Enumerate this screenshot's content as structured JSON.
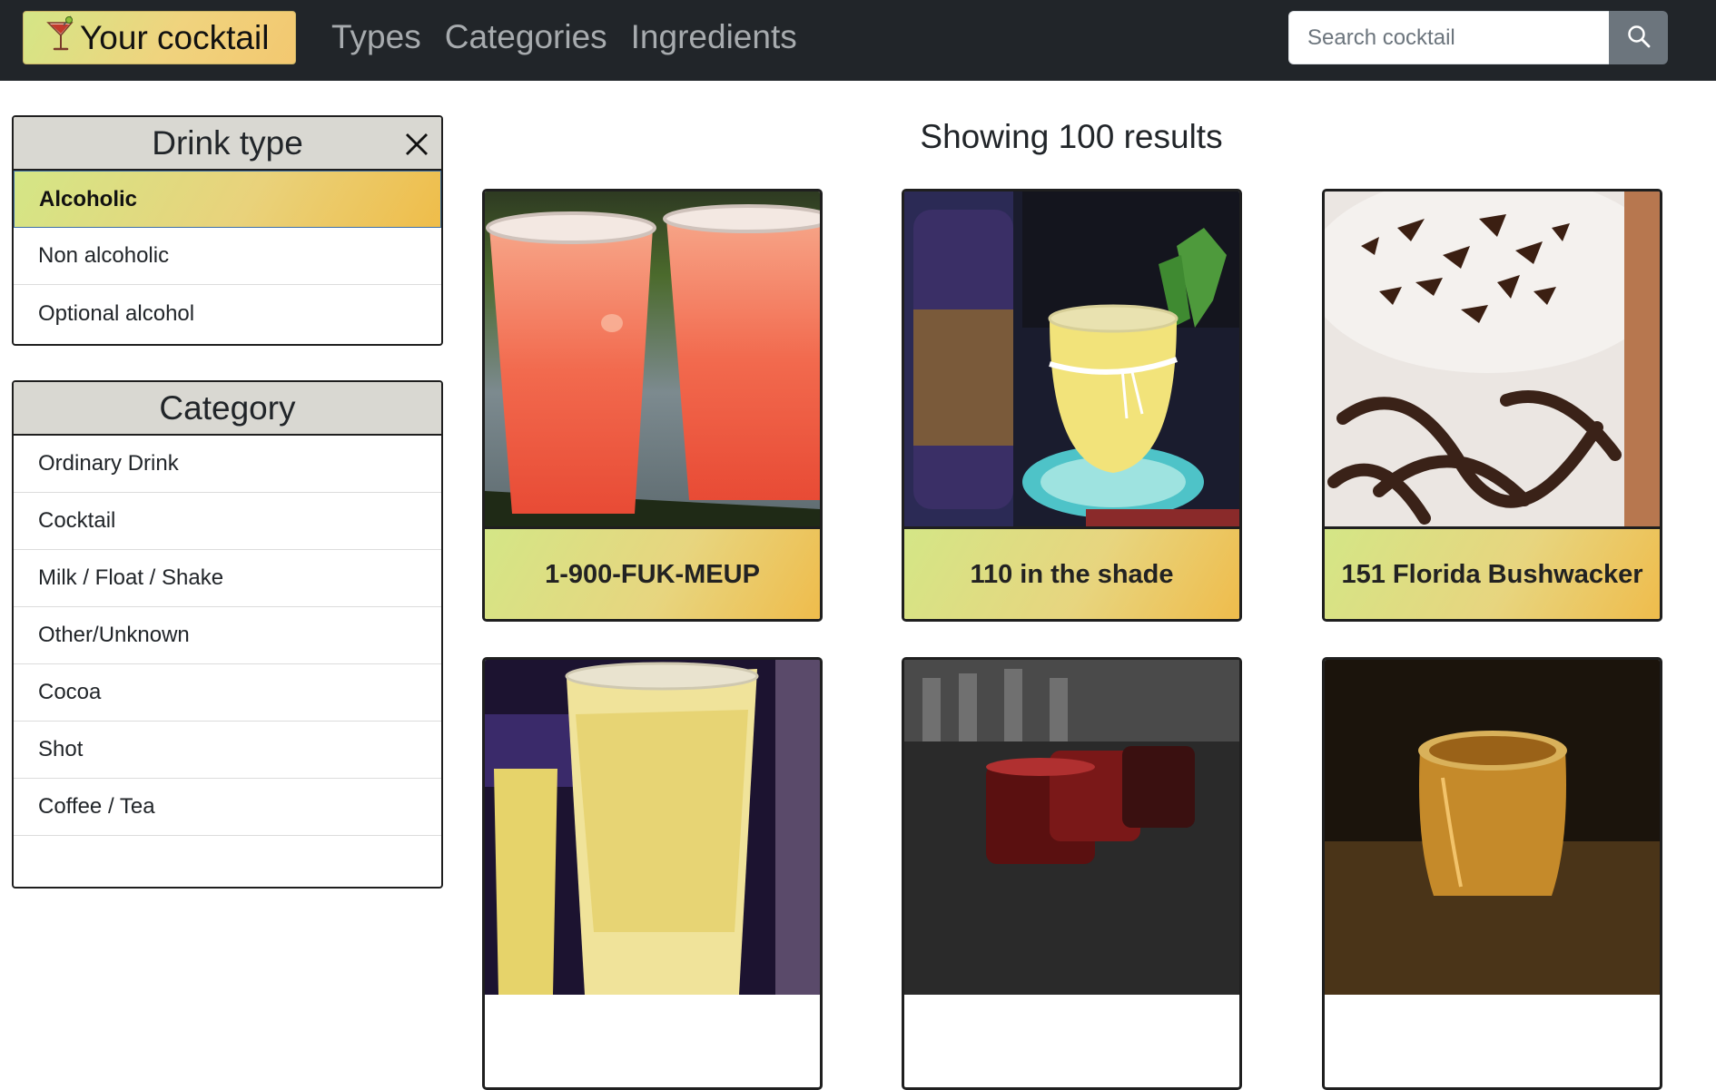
{
  "navbar": {
    "brand": {
      "icon": "cocktail-glass-icon",
      "label": "Your cocktail"
    },
    "links": [
      "Types",
      "Categories",
      "Ingredients"
    ],
    "search": {
      "placeholder": "Search cocktail",
      "value": "",
      "icon": "search-icon"
    }
  },
  "sidebar": {
    "drink_type": {
      "title": "Drink type",
      "close_icon": "close-icon",
      "items": [
        {
          "label": "Alcoholic",
          "active": true
        },
        {
          "label": "Non alcoholic",
          "active": false
        },
        {
          "label": "Optional alcohol",
          "active": false
        }
      ]
    },
    "category": {
      "title": "Category",
      "items": [
        {
          "label": "Ordinary Drink"
        },
        {
          "label": "Cocktail"
        },
        {
          "label": "Milk / Float / Shake"
        },
        {
          "label": "Other/Unknown"
        },
        {
          "label": "Cocoa"
        },
        {
          "label": "Shot"
        },
        {
          "label": "Coffee / Tea"
        }
      ]
    }
  },
  "main": {
    "heading": "Showing 100 results",
    "cards": [
      {
        "name": "1-900-FUK-MEUP",
        "image": "red-cocktail-cups-photo"
      },
      {
        "name": "110 in the shade",
        "image": "whiskey-cocktail-glass-photo"
      },
      {
        "name": "151 Florida Bushwacker",
        "image": "chocolate-milkshake-photo"
      },
      {
        "name": "",
        "image": "yellow-drink-bar-photo"
      },
      {
        "name": "",
        "image": "red-shot-glasses-photo"
      },
      {
        "name": "",
        "image": "amber-shot-glass-photo"
      }
    ]
  },
  "colors": {
    "navbar_bg": "#212529",
    "accent_gradient_start": "#d4e686",
    "accent_gradient_end": "#efbc4c",
    "panel_header_bg": "#d9d8d2",
    "search_button_bg": "#6c757d"
  }
}
